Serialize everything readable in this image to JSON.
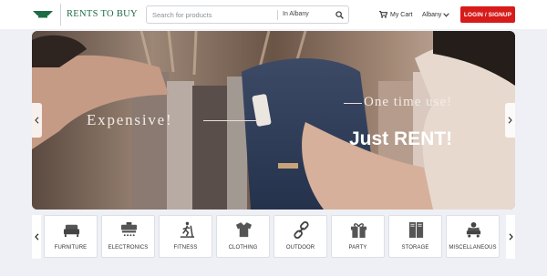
{
  "header": {
    "brand": "RENTS TO BUY",
    "search": {
      "placeholder": "Search for products",
      "location": "In Albany"
    },
    "cart_label": "My Cart",
    "city": "Albany",
    "login_label": "LOGIN / SIGNUP"
  },
  "hero": {
    "text_left": "Expensive!",
    "text_right": "One time use!",
    "text_cta": "Just RENT!"
  },
  "categories": [
    {
      "label": "FURNITURE",
      "icon": "sofa-icon"
    },
    {
      "label": "ELECTRONICS",
      "icon": "appliance-icon"
    },
    {
      "label": "FITNESS",
      "icon": "treadmill-icon"
    },
    {
      "label": "CLOTHING",
      "icon": "shirt-icon"
    },
    {
      "label": "OUTDOOR",
      "icon": "chain-link-icon"
    },
    {
      "label": "PARTY",
      "icon": "gift-icon"
    },
    {
      "label": "STORAGE",
      "icon": "locker-icon"
    },
    {
      "label": "MISCELLANEOUS",
      "icon": "person-cart-icon"
    }
  ],
  "colors": {
    "brand_green": "#1f6b45",
    "login_red": "#d71a1a",
    "page_bg": "#eef0f6"
  }
}
